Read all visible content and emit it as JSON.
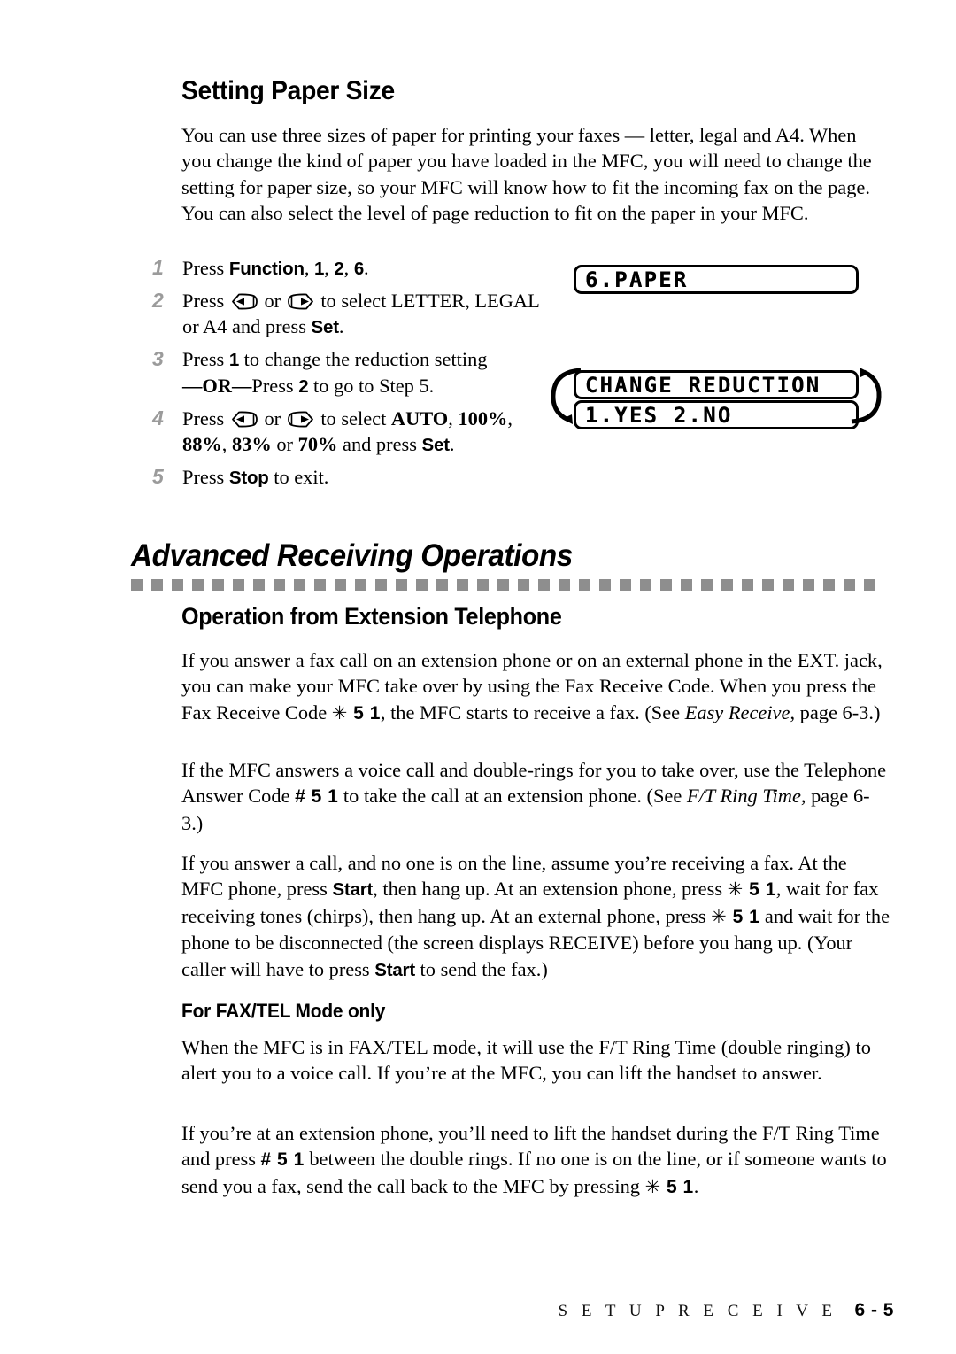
{
  "page": {
    "footer_title": "S E T U P   R E C E I V E",
    "footer_page": "6 - 5"
  },
  "paper_size_section": {
    "heading": "Setting Paper Size",
    "intro": "You can use three sizes of paper for printing your faxes — letter, legal and A4. When you change the kind of paper you have loaded in the MFC, you will need to change the setting for paper size, so your MFC will know how to fit the incoming fax on the page.  You can also select the level of page reduction to fit on the paper in your MFC.",
    "steps": [
      {
        "num": "1",
        "pre": "Press ",
        "key1": "Function",
        "mid1": ", ",
        "key2": "1",
        "mid2": ", ",
        "key3": "2",
        "mid3": ", ",
        "key4": "6",
        "post": "."
      },
      {
        "num": "2",
        "pre": "Press ",
        "mid": " or ",
        "post": " to select LETTER, LEGAL or A4 and press ",
        "key_set": "Set",
        "end": "."
      },
      {
        "num": "3",
        "pre": "Press ",
        "key_1": "1",
        "mid": " to change the reduction setting",
        "or_dash_left": "—",
        "or_label": "OR",
        "or_dash_right": "—",
        "post_pre": "Press ",
        "key_2": "2",
        "post": " to go to Step 5."
      },
      {
        "num": "4",
        "pre": "Press ",
        "mid": " or ",
        "post": " to select ",
        "opt1": "AUTO",
        "sep1": ", ",
        "opt2": "100%",
        "sep2": ", ",
        "opt3": "88%",
        "sep3": ", ",
        "opt4": "83%",
        "sep4": " or ",
        "opt5": "70%",
        "tail": " and press ",
        "key_set": "Set",
        "end": "."
      },
      {
        "num": "5",
        "pre": "Press ",
        "key_stop": "Stop",
        "post": " to exit."
      }
    ],
    "lcd": {
      "paper": "6.PAPER",
      "change_reduction": "CHANGE REDUCTION",
      "yes_no": "1.YES 2.NO"
    }
  },
  "advanced_section": {
    "chapter_heading": "Advanced Receiving Operations",
    "sub_heading": "Operation from Extension Telephone",
    "paragraph_1": {
      "a": "If you answer a fax call on an extension phone or on an external phone in the EXT. jack, you can make your MFC take over by using the Fax Receive Code. When you press the Fax Receive Code ",
      "code": "✳ 5 1",
      "b": ", the MFC starts to receive a fax. (See ",
      "italic": "Easy Receive",
      "c": ", page 6-3.)"
    },
    "paragraph_2": {
      "a": "If the MFC answers a voice call and double-rings for you to take over, use the Telephone Answer Code ",
      "code": "# 5 1",
      "b": " to take the call at an extension phone. (See ",
      "italic": "F/T Ring Time",
      "c": ", page 6-3.)"
    },
    "paragraph_3": {
      "a": "If you answer a call, and no one is on the line, assume you’re receiving a fax. At the MFC phone, press ",
      "key1": "Start",
      "b": ", then hang up. At an extension phone, press ",
      "code1": "✳ 5 1",
      "c": ", wait for fax receiving tones (chirps), then hang up.  At an external phone, press ",
      "code2": "✳ 5 1",
      "d": " and wait for the phone to be disconnected (the screen displays RECEIVE) before you hang up. (Your caller will have to press ",
      "key2": "Start",
      "e": " to send the fax.)"
    },
    "faxtel_heading": "For FAX/TEL Mode only",
    "paragraph_4": "When the MFC is in FAX/TEL mode, it will use the F/T Ring Time (double ringing) to alert you to a voice call. If you’re at the MFC, you can lift the handset to answer.",
    "paragraph_5": {
      "a": "If you’re at an extension phone, you’ll need to lift the handset during the F/T Ring Time and press ",
      "code1": "# 5 1",
      "b": " between the double rings. If no one is on the line, or if someone wants to send you a fax, send the call back to the MFC by pressing ",
      "code2": "✳ 5 1",
      "c": "."
    }
  },
  "colors": {
    "step_number": "#9b9b9b",
    "dash_rule": "#8e8e8e",
    "text": "#000000",
    "background": "#ffffff"
  }
}
